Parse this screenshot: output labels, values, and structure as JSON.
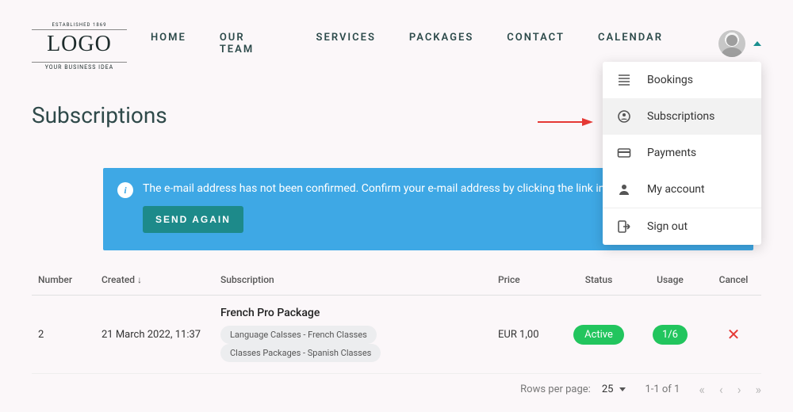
{
  "logo": {
    "established": "ESTABLISHED 1869",
    "main": "LOGO",
    "sub": "YOUR BUSINESS IDEA"
  },
  "nav": {
    "home": "HOME",
    "team": "OUR TEAM",
    "services": "SERVICES",
    "packages": "PACKAGES",
    "contact": "CONTACT",
    "calendar": "CALENDAR"
  },
  "page": {
    "title": "Subscriptions"
  },
  "dropdown": {
    "bookings": "Bookings",
    "subscriptions": "Subscriptions",
    "payments": "Payments",
    "account": "My account",
    "signout": "Sign out"
  },
  "alert": {
    "text": "The e-mail address has not been confirmed. Confirm your e-mail address by clicking the link in the se",
    "button": "SEND AGAIN"
  },
  "table": {
    "headers": {
      "number": "Number",
      "created": "Created",
      "subscription": "Subscription",
      "price": "Price",
      "status": "Status",
      "usage": "Usage",
      "cancel": "Cancel"
    },
    "row": {
      "number": "2",
      "created": "21 March 2022, 11:37",
      "title": "French Pro Package",
      "chip1": "Language Calsses - French Classes",
      "chip2": "Classes Packages - Spanish Classes",
      "price": "EUR 1,00",
      "status": "Active",
      "usage": "1/6"
    }
  },
  "pager": {
    "rpp_label": "Rows per page:",
    "rpp_value": "25",
    "range": "1-1 of 1"
  }
}
